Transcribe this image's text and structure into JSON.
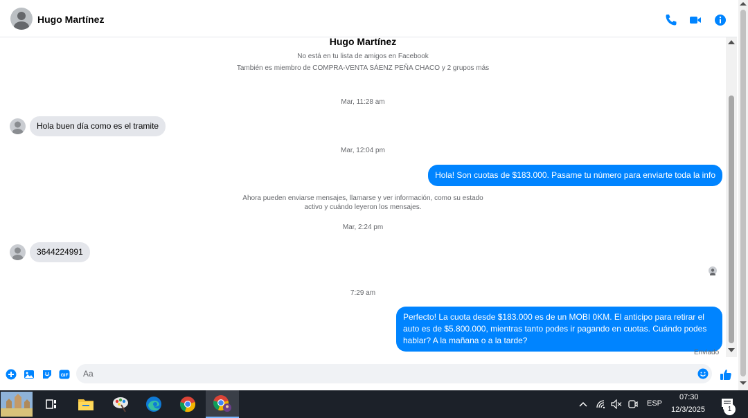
{
  "header": {
    "contact_name": "Hugo Martínez",
    "icons": [
      "phone-icon",
      "video-camera-icon",
      "info-icon"
    ],
    "accent_color": "#0084ff"
  },
  "profile": {
    "name": "Hugo Martínez",
    "friend_status": "No está en tu lista de amigos en Facebook",
    "groups": "También es miembro de COMPRA-VENTA SÁENZ PEÑA CHACO y 2 grupos más"
  },
  "conversation": {
    "ts1": "Mar, 11:28 am",
    "msg1": "Hola buen día como es el tramite",
    "ts2": "Mar, 12:04 pm",
    "msg2": "Hola! Son cuotas de $183.000. Pasame tu número para enviarte toda la info",
    "notice_line1": "Ahora pueden enviarse mensajes, llamarse y ver información, como su estado",
    "notice_line2": "activo y cuándo leyeron los mensajes.",
    "ts3": "Mar, 2:24 pm",
    "msg3": "3644224991",
    "ts4": "7:29 am",
    "msg4_line1": "Perfecto! La cuota desde $183.000 es de un MOBI 0KM. El anticipo para retirar el",
    "msg4_line2": "auto es de $5.800.000, mientras tanto podes ir pagando en cuotas. Cuándo podes",
    "msg4_line3": "hablar? A la mañana o a la tarde?",
    "status": "Enviado"
  },
  "composer": {
    "placeholder": "Aa",
    "icons": [
      "plus-icon",
      "photo-icon",
      "sticker-icon",
      "gif-icon",
      "emoji-icon",
      "thumbs-up-icon"
    ]
  },
  "taskbar": {
    "apps": [
      "start-button",
      "task-view-icon",
      "file-explorer-icon",
      "paint-icon",
      "edge-icon",
      "chrome-icon",
      "chrome-profile-icon"
    ],
    "language": "ESP",
    "time": "07:30",
    "date": "12/3/2025",
    "notification_count": "1"
  }
}
